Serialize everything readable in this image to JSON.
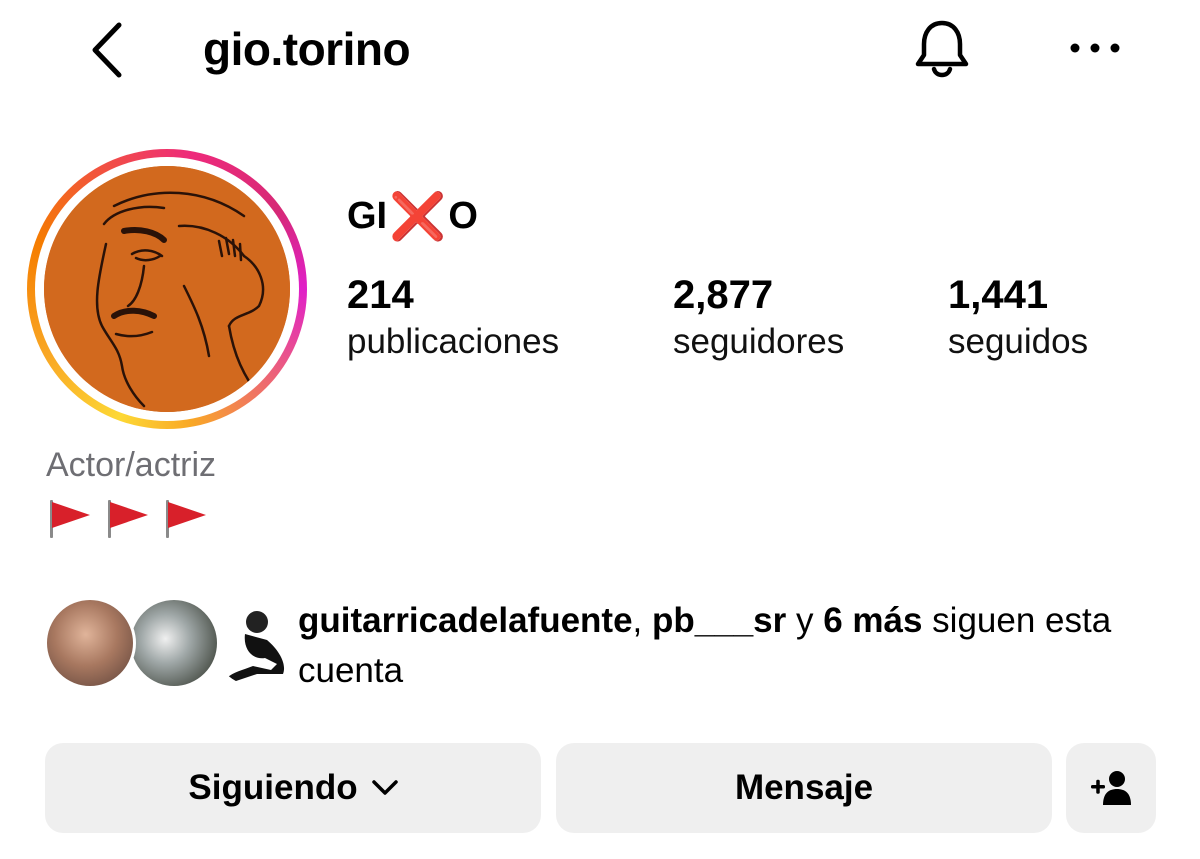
{
  "header": {
    "username": "gio.torino",
    "back_icon": "chevron-left-icon",
    "bell_icon": "bell-icon",
    "more_icon": "more-horizontal-icon"
  },
  "profile": {
    "display_name_left": "GI",
    "display_name_mark": "❌",
    "display_name_right": "O",
    "category": "Actor/actriz",
    "bio_flags": [
      "🚩",
      "🚩",
      "🚩"
    ],
    "avatar_ring_colors": [
      "#fdd835",
      "#f57c00",
      "#ee2a7b",
      "#e020c8"
    ]
  },
  "stats": [
    {
      "value": "214",
      "label": "publicaciones"
    },
    {
      "value": "2,877",
      "label": "seguidores"
    },
    {
      "value": "1,441",
      "label": "seguidos"
    }
  ],
  "mutual": {
    "user1": "guitarricadelafuente",
    "sep1": ", ",
    "user2": "pb___sr",
    "connector": " y ",
    "more": "6 más",
    "suffix": " siguen esta cuenta"
  },
  "actions": {
    "following_label": "Siguiendo",
    "following_icon": "chevron-down-icon",
    "message_label": "Mensaje",
    "add_user_icon": "add-user-icon",
    "button_bg": "#efefef"
  }
}
